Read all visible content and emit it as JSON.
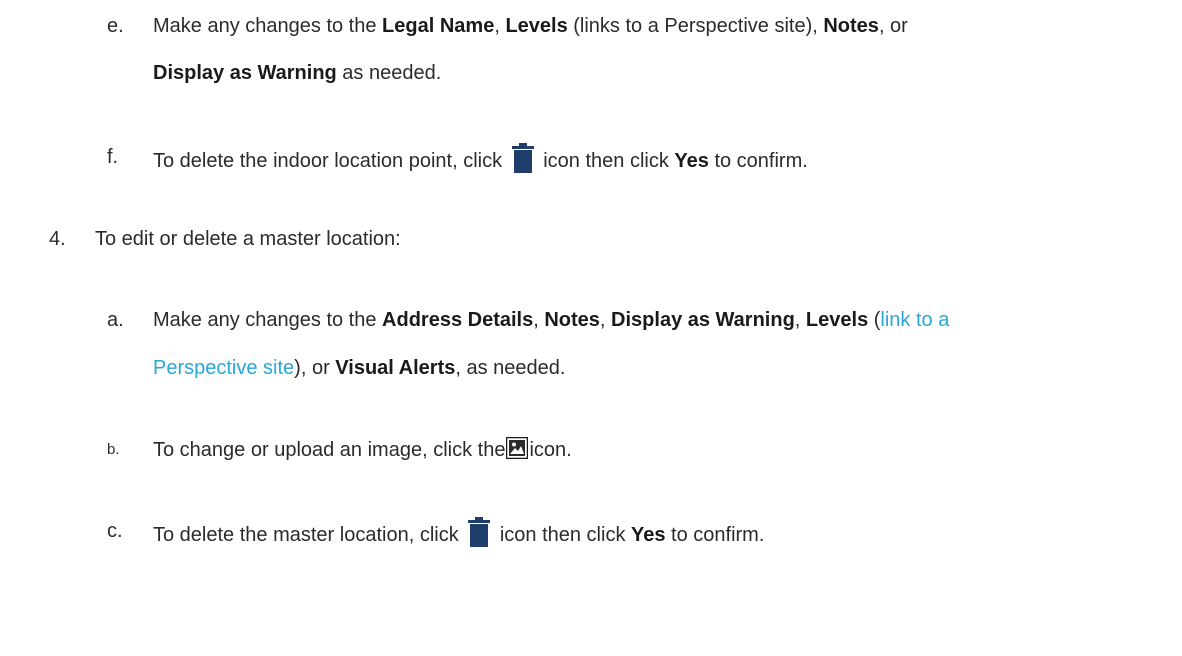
{
  "step3": {
    "e": {
      "marker": "e.",
      "part1": "Make any changes to the ",
      "b1": "Legal Name",
      "sep1": ", ",
      "b2": "Levels",
      "part2": " (links to a Perspective site), ",
      "b3": "Notes",
      "part3": ", or",
      "b4": "Display as Warning",
      "part4": " as needed."
    },
    "f": {
      "marker": "f.",
      "part1": "To delete the indoor location point, click",
      "part2": "icon then click ",
      "b1": "Yes",
      "part3": " to confirm.",
      "icon": "trash-icon"
    }
  },
  "step4": {
    "marker": "4.",
    "text": "To edit or delete a master location:",
    "a": {
      "marker": "a.",
      "part1": "Make any changes to the ",
      "b1": "Address Details",
      "sep1": ", ",
      "b2": "Notes",
      "sep2": ", ",
      "b3": "Display as Warning",
      "sep3": ", ",
      "b4": "Levels",
      "part2": " (",
      "link1": "link to a",
      "link2": "Perspective site",
      "part3": "), or ",
      "b5": "Visual Alerts",
      "part4": ", as needed."
    },
    "b": {
      "marker": "b.",
      "part1": "To change or upload an image, click the",
      "part2": "icon.",
      "icon": "image-icon"
    },
    "c": {
      "marker": "c.",
      "part1": "To delete the master location, click",
      "part2": "icon then click ",
      "b1": "Yes",
      "part3": " to confirm.",
      "icon": "trash-icon"
    }
  },
  "colors": {
    "link": "#28a7d8",
    "icon": "#1f3e6b"
  }
}
